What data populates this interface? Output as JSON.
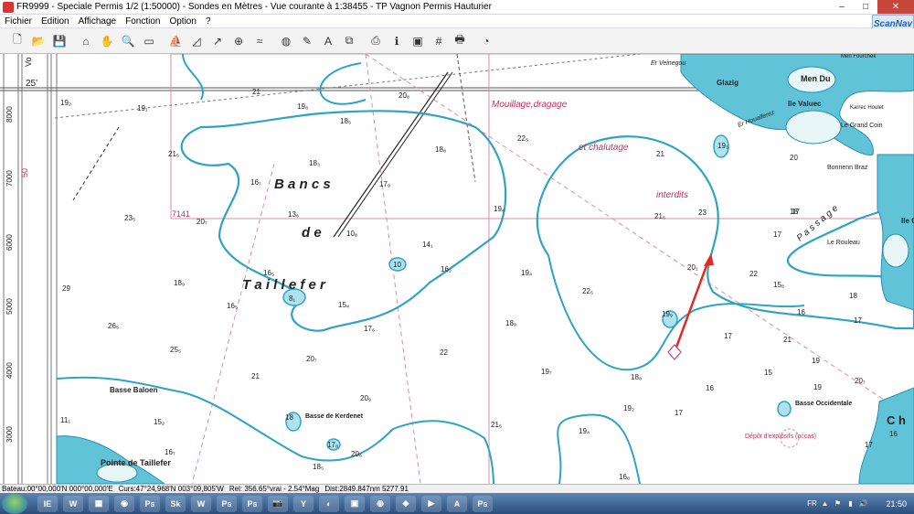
{
  "window": {
    "title": "FR9999 - Speciale Permis 1/2 (1:50000) - Sondes en Mètres - Vue courante à 1:38455 - TP Vagnon Permis Hauturier",
    "min": "–",
    "max": "□",
    "close": "✕"
  },
  "menu": [
    "Fichier",
    "Edition",
    "Affichage",
    "Fonction",
    "Option",
    "?"
  ],
  "logo": "ScanNav",
  "toolbar": [
    {
      "name": "new-icon",
      "glyph": "🗋"
    },
    {
      "name": "open-icon",
      "glyph": "📂"
    },
    {
      "name": "save-icon",
      "glyph": "💾"
    },
    {
      "name": "home-icon",
      "glyph": "⌂"
    },
    {
      "name": "hand-icon",
      "glyph": "✋"
    },
    {
      "name": "zoom-icon",
      "glyph": "🔍"
    },
    {
      "name": "frame-icon",
      "glyph": "▭"
    },
    {
      "name": "boat-icon",
      "glyph": "⛵"
    },
    {
      "name": "route-icon",
      "glyph": "◿"
    },
    {
      "name": "bearing-icon",
      "glyph": "↗"
    },
    {
      "name": "target-icon",
      "glyph": "⊕"
    },
    {
      "name": "track-icon",
      "glyph": "≈"
    },
    {
      "name": "buoy-icon",
      "glyph": "◍"
    },
    {
      "name": "pen-icon",
      "glyph": "✎"
    },
    {
      "name": "text-icon",
      "glyph": "A"
    },
    {
      "name": "layers-icon",
      "glyph": "⧉"
    },
    {
      "name": "print-icon",
      "glyph": "⎙"
    },
    {
      "name": "info-icon",
      "glyph": "ℹ"
    },
    {
      "name": "chart-icon",
      "glyph": "▣"
    },
    {
      "name": "grid-icon",
      "glyph": "#"
    },
    {
      "name": "printer-icon",
      "glyph": "🖶"
    },
    {
      "name": "compass-icon",
      "glyph": "◔"
    }
  ],
  "map": {
    "labels": {
      "lat25": "25'",
      "scale7141": "7141",
      "bancs": "B a n c s",
      "de": "d e",
      "taillefer": "T a i l l e f e r",
      "mouillage": "Mouillage,dragage",
      "chalutage": "et chalutage",
      "interdits": "interdits",
      "passage": "P a s s a g e",
      "basse_baloen": "Basse Baloen",
      "basse_kerdenet": "Basse de Kerdenet",
      "pointe": "Pointe de Taillefer",
      "basse_occidentale": "Basse Occidentale",
      "depot": "Dépôt d'explosifs (occas)",
      "er_veinegou": "Er Veinegou",
      "men_du": "Men Du",
      "ile_glazig": "Glazig",
      "ile_valuec": "Ile Valuec",
      "grand_coin": "Le Grand Coin",
      "bonnenn": "Bonnenn Braz",
      "er_houallerez": "Er Houallerez",
      "le_rouleau": "Le Rouleau",
      "karrec": "Karrec Houlet",
      "men_fourchek": "Men Fourchek",
      "ile_gur": "Ile Gur",
      "ch": "C h",
      "vo": "Vo"
    },
    "soundings": [
      "19₂",
      "19₁",
      "21",
      "20₈",
      "19₈",
      "18₅",
      "18₈",
      "22₅",
      "21",
      "21₅",
      "16₇",
      "18₃",
      "17₉",
      "13₆",
      "10₈",
      "19₄",
      "21₅",
      "23",
      "23₅",
      "20₇",
      "18₉",
      "16₅",
      "14₁",
      "16₂",
      "19₄",
      "22₅",
      "20₁",
      "22",
      "15₈",
      "17",
      "26₅",
      "25₅",
      "16₅",
      "15₄",
      "17₆",
      "22",
      "18₉",
      "19₉",
      "17",
      "29",
      "21",
      "20₉",
      "20₇",
      "19₇",
      "18₈",
      "16",
      "15",
      "11₁",
      "15₂",
      "16₇",
      "18",
      "17₈",
      "20₆",
      "18₅",
      "21₅",
      "19₄",
      "19₂",
      "17",
      "18",
      "16₈",
      "19₃",
      "20",
      "17",
      "21",
      "17",
      "19",
      "17",
      "18",
      "16",
      "19",
      "20₇",
      "16",
      "10",
      "8₁"
    ],
    "depth_ticks": [
      "8000",
      "7000",
      "6000",
      "5000",
      "4000",
      "3000"
    ],
    "scale_mark": "50"
  },
  "status": {
    "bateau": "Bateau:00°00,000'N 000°00,000'E",
    "curs": "Curs:47°24,968'N 003°09,805'W",
    "rel": "Rel: 356.65°vrai - 2.54°Mag",
    "dist": "Dist:2849.847nm  5277.91"
  },
  "taskbar": {
    "apps": [
      "IE",
      "W",
      "▦",
      "◉",
      "Ps",
      "Sk",
      "W",
      "Ps",
      "Ps",
      "📷",
      "Y",
      "◐",
      "▣",
      "◍",
      "◈",
      "▶",
      "A",
      "Ps"
    ],
    "time": "21:50"
  },
  "colors": {
    "sea_light": "#aee3ee",
    "sea_line": "#2fa3c4",
    "land": "#61c3d8",
    "route": "#e8271f",
    "grid": "#e28aa0",
    "rulers": "#7a7a7a"
  }
}
